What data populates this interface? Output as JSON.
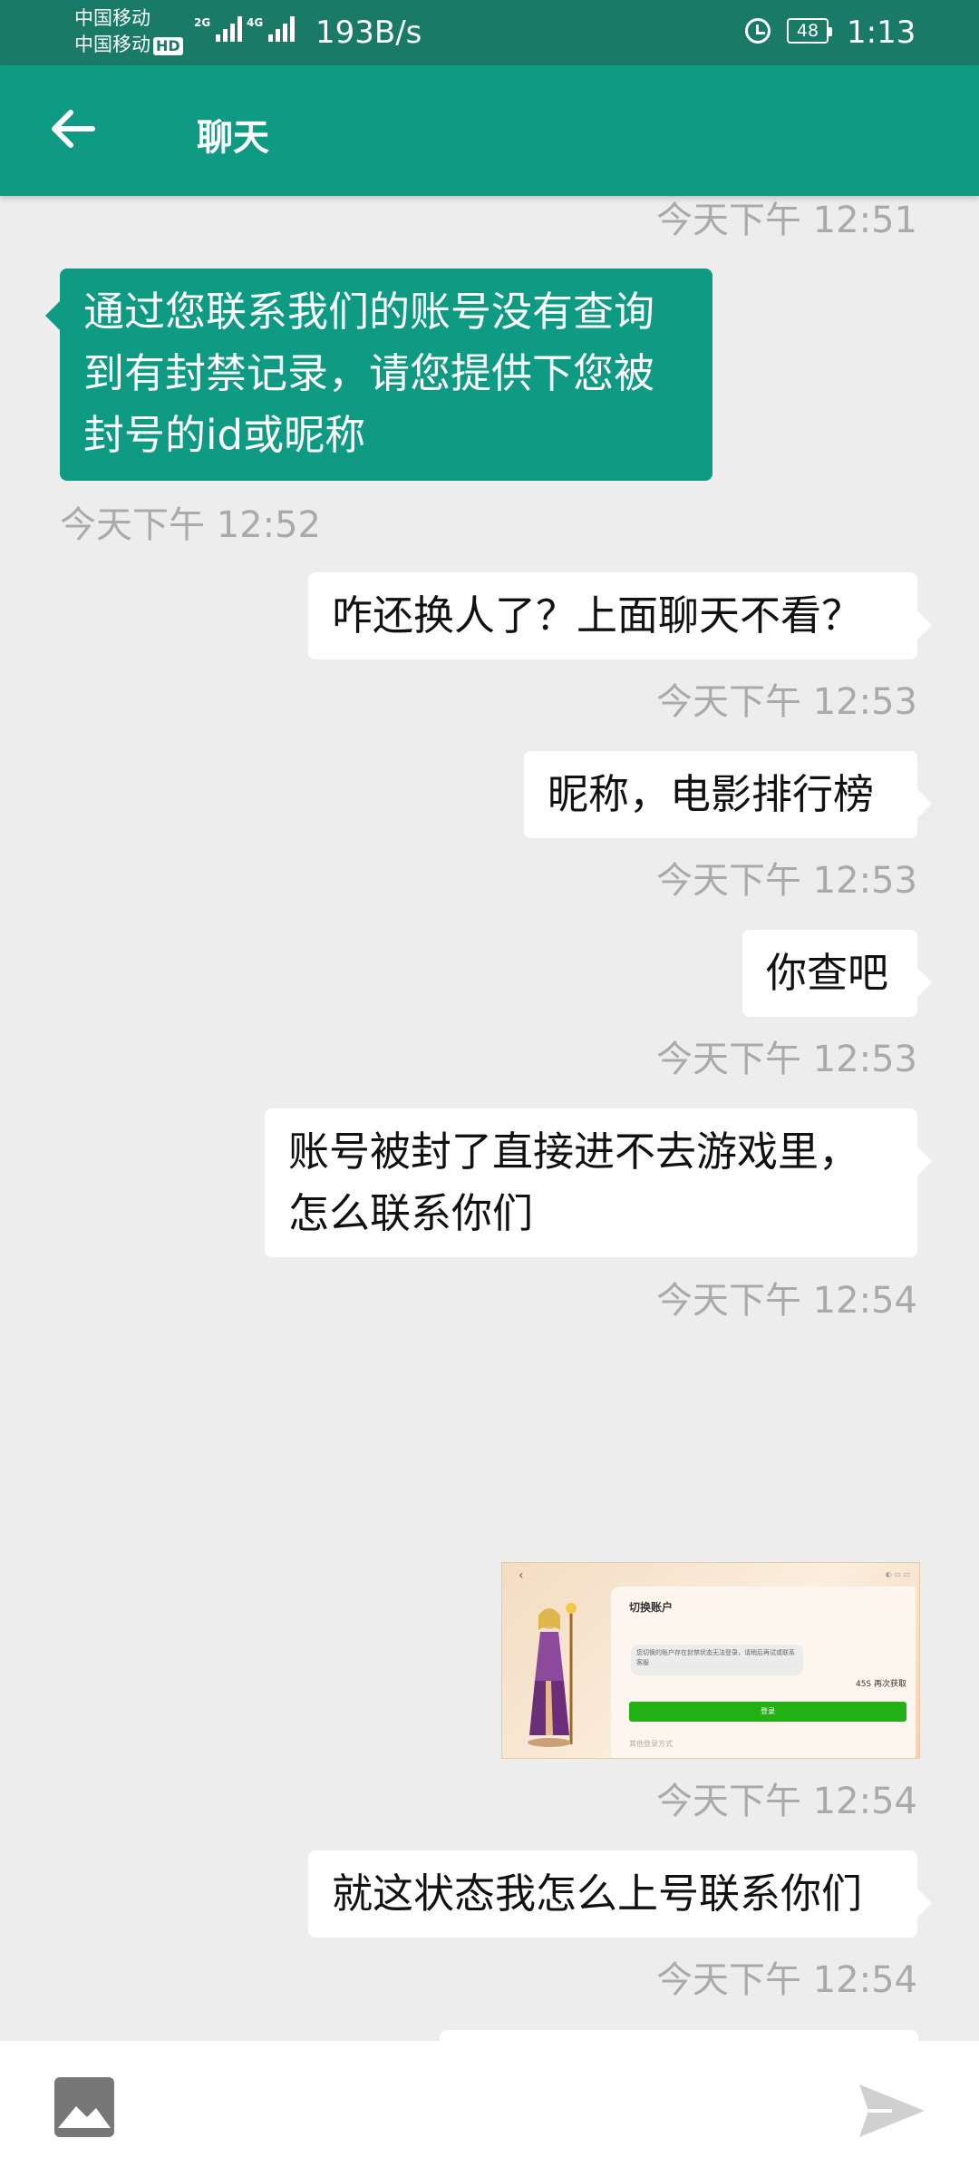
{
  "status_bar": {
    "carrier_top": "中国移动",
    "carrier_bottom": "中国移动",
    "hd_badge": "HD",
    "net_type_1": "2G",
    "net_type_2": "4G",
    "speed": "193B/s",
    "battery": "48",
    "time": "1:13"
  },
  "header": {
    "title": "聊天"
  },
  "messages": [
    {
      "time": "今天下午 12:51"
    },
    {
      "lines": [
        "通过您联系我们的账号没有查询",
        "到有封禁记录，请您提供下您被",
        "封号的id或昵称"
      ],
      "time": "今天下午 12:52"
    },
    {
      "lines": [
        "咋还换人了？上面聊天不看？"
      ],
      "time": "今天下午 12:53"
    },
    {
      "lines": [
        "昵称，电影排行榜"
      ],
      "time": "今天下午 12:53"
    },
    {
      "lines": [
        "你查吧"
      ],
      "time": "今天下午 12:53"
    },
    {
      "lines": [
        "账号被封了直接进不去游戏里，",
        "怎么联系你们"
      ],
      "time": "今天下午 12:54"
    },
    {
      "image": {
        "title": "切换账户",
        "message": "您切换的账户存在封禁状态无法登录，请稍后再试或联系客服",
        "timer": "45S 再次获取",
        "button": "登录",
        "other": "其他登录方式"
      },
      "time": "今天下午 12:54"
    },
    {
      "lines": [
        "就这状态我怎么上号联系你们"
      ],
      "time": "今天下午 12:54"
    }
  ],
  "colors": {
    "status_bar": "#1a7a68",
    "header": "#0e9a83",
    "background": "#ededed",
    "timestamp": "#aaaaaa"
  },
  "icons": {
    "back": "back-arrow-icon",
    "image": "image-icon",
    "send": "send-icon",
    "alarm": "alarm-icon"
  }
}
